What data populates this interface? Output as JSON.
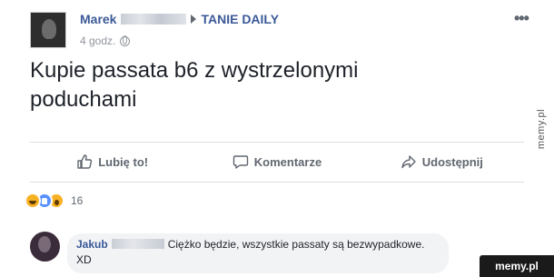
{
  "post": {
    "author": "Marek",
    "group": "TANIE DAILY",
    "time": "4 godz.",
    "text": "Kupie passata b6 z wystrzelonymi poduchami",
    "more_icon": "more-icon"
  },
  "actions": {
    "like": "Lubię to!",
    "comment": "Komentarze",
    "share": "Udostępnij"
  },
  "reactions": {
    "count": "16",
    "types": [
      "haha",
      "like",
      "wow"
    ]
  },
  "comment": {
    "author": "Jakub",
    "text": "Ciężko będzie, wszystkie passaty są bezwypadkowe. XD"
  },
  "watermarks": {
    "side": "memy.pl",
    "corner": "memy.pl"
  },
  "colors": {
    "link": "#3b5998",
    "like_blue": "#5890ff",
    "reaction_yellow": "#f7b125",
    "watermark_bg": "#1a1a1a"
  }
}
